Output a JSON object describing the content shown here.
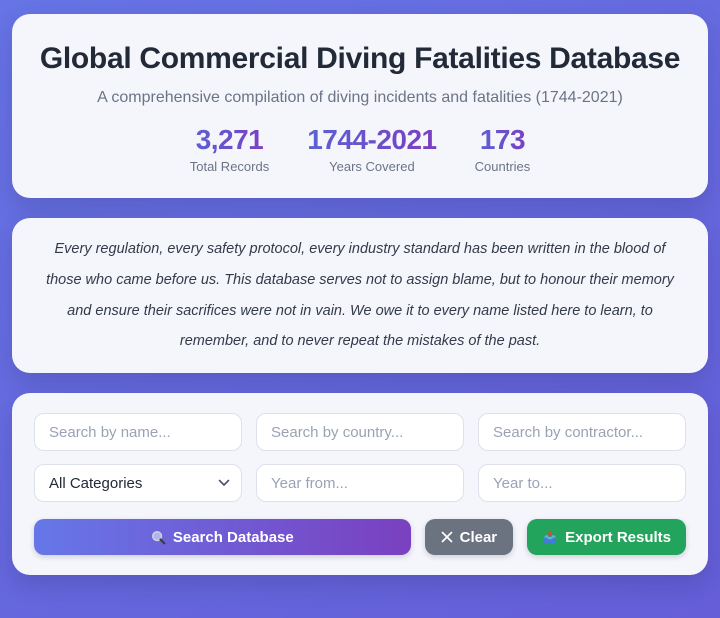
{
  "header": {
    "title": "Global Commercial Diving Fatalities Database",
    "subtitle": "A comprehensive compilation of diving incidents and fatalities (1744-2021)",
    "stats": [
      {
        "value": "3,271",
        "label": "Total Records"
      },
      {
        "value": "1744-2021",
        "label": "Years Covered"
      },
      {
        "value": "173",
        "label": "Countries"
      }
    ]
  },
  "quote": {
    "text": "Every regulation, every safety protocol, every industry standard has been written in the blood of those who came before us. This database serves not to assign blame, but to honour their memory and ensure their sacrifices were not in vain. We owe it to every name listed here to learn, to remember, and to never repeat the mistakes of the past."
  },
  "search": {
    "name_placeholder": "Search by name...",
    "country_placeholder": "Search by country...",
    "contractor_placeholder": "Search by contractor...",
    "category_selected": "All Categories",
    "year_from_placeholder": "Year from...",
    "year_to_placeholder": "Year to...",
    "buttons": {
      "search_label": "Search Database",
      "search_icon": "magnifier",
      "clear_label": "Clear",
      "clear_icon": "cross",
      "export_label": "Export Results",
      "export_icon": "inbox-tray"
    }
  },
  "colors": {
    "page_background_start": "#6674e4",
    "page_background_end": "#655ed8",
    "card_background": "#f5f6fb",
    "title_text": "#222937",
    "muted_text": "#6b7486",
    "stat_gradient_start": "#5a62d3",
    "stat_gradient_end": "#7d3ec0",
    "search_button_gradient_start": "#6677e8",
    "search_button_gradient_end": "#7a40c0",
    "clear_button": "#6b7280",
    "export_button": "#23a45c",
    "input_border": "#dde1ec"
  }
}
